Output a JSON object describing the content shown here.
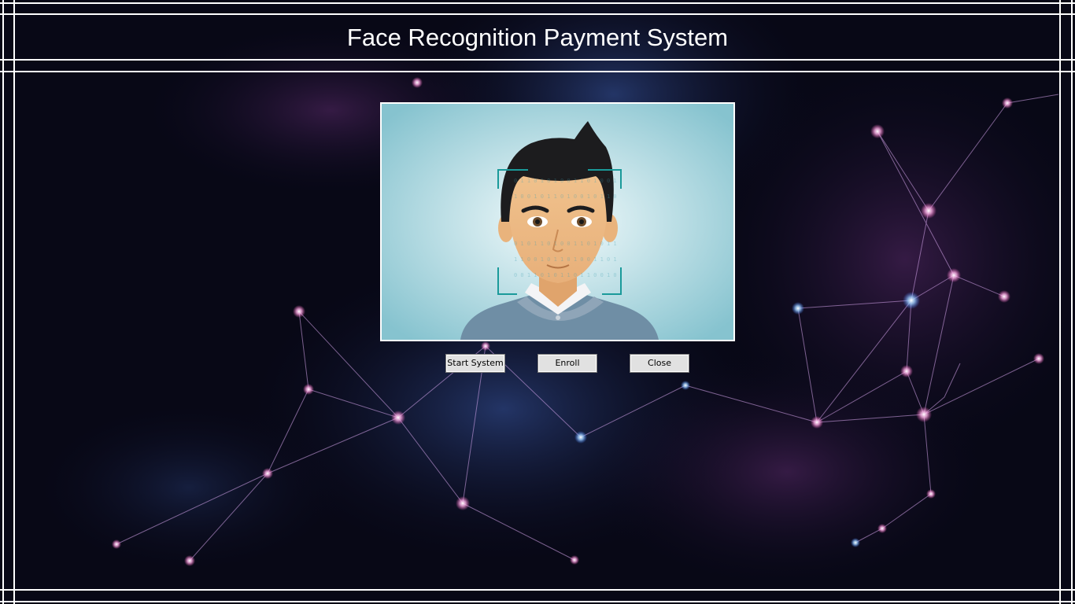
{
  "window": {
    "title": "Face Recognition Payment System"
  },
  "preview": {
    "image_description_icon": "face-avatar-icon"
  },
  "buttons": {
    "start_label": "Start System",
    "enroll_label": "Enroll",
    "close_label": "Close"
  },
  "colors": {
    "background": "#070713",
    "frame_lines": "#ffffff",
    "title_text": "#ffffff",
    "button_face": "#e1e1e1",
    "scan_bracket": "#1a9a9a"
  }
}
